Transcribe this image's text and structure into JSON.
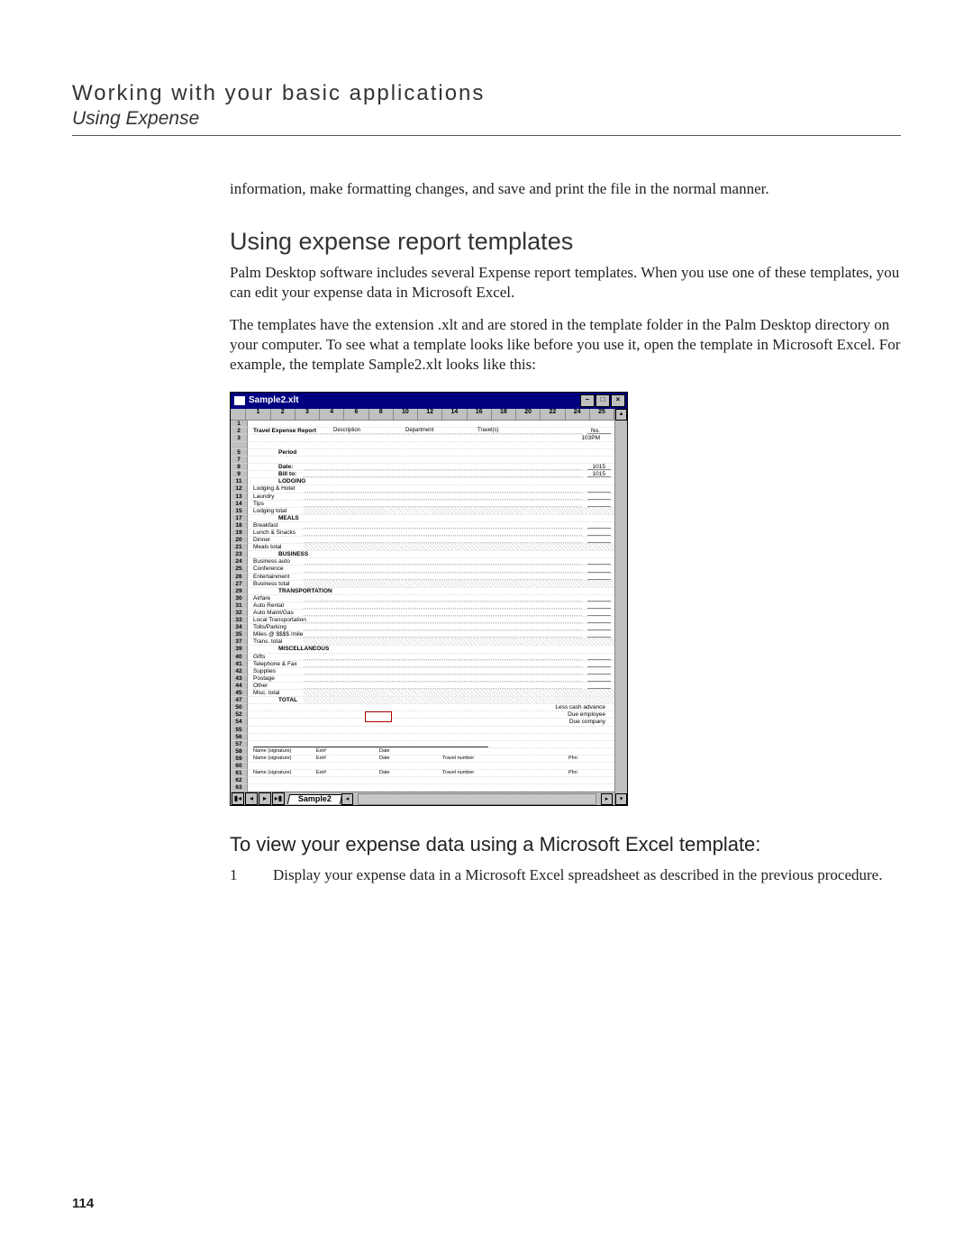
{
  "header": {
    "title": "Working with your basic applications",
    "subtitle": "Using Expense"
  },
  "lead_fragment": "information, make formatting changes, and save and print the file in the normal manner.",
  "section_heading": "Using expense report templates",
  "para1": "Palm Desktop software includes several Expense report templates. When you use one of these templates, you can edit your expense data in Microsoft Excel.",
  "para2": "The templates have the extension .xlt and are stored in the template folder in the Palm Desktop directory on your computer. To see what a template looks like before you use it, open the template in Microsoft Excel. For example, the template Sample2.xlt looks like this:",
  "excel": {
    "window_title": "Sample2.xlt",
    "col_headers": [
      "1",
      "2",
      "3",
      "4",
      "6",
      "8",
      "10",
      "12",
      "14",
      "16",
      "18",
      "20",
      "22",
      "24",
      "25"
    ],
    "rows": [
      {
        "n": "1",
        "label": "",
        "kind": "blank"
      },
      {
        "n": "2",
        "label": "Travel Expense Report",
        "kind": "bold",
        "extra_labels": [
          "Description",
          "Department",
          "Travel(s)"
        ],
        "right": "",
        "right2": "No."
      },
      {
        "n": "3",
        "label": "",
        "kind": "blank",
        "right2": "103PM"
      },
      {
        "n": "",
        "label": "",
        "kind": "blank"
      },
      {
        "n": "5",
        "label": "",
        "kind": "sub",
        "sublabel": "Period"
      },
      {
        "n": "7",
        "label": "",
        "kind": "blank"
      },
      {
        "n": "8",
        "label": "",
        "kind": "right",
        "sublabel": "Date:",
        "right": "1015"
      },
      {
        "n": "9",
        "label": "",
        "kind": "right",
        "sublabel": "Bill to:",
        "right": "1015"
      },
      {
        "n": "11",
        "label": "",
        "kind": "section",
        "sublabel": "LODGING"
      },
      {
        "n": "12",
        "label": "Lodging & Hotel",
        "kind": "item"
      },
      {
        "n": "13",
        "label": "Laundry",
        "kind": "item"
      },
      {
        "n": "14",
        "label": "Tips",
        "kind": "item"
      },
      {
        "n": "15",
        "label": "Lodging total",
        "kind": "shaded"
      },
      {
        "n": "17",
        "label": "",
        "kind": "section",
        "sublabel": "MEALS"
      },
      {
        "n": "18",
        "label": "Breakfast",
        "kind": "item"
      },
      {
        "n": "19",
        "label": "Lunch & Snacks",
        "kind": "item"
      },
      {
        "n": "20",
        "label": "Dinner",
        "kind": "item"
      },
      {
        "n": "21",
        "label": "Meals total",
        "kind": "shaded"
      },
      {
        "n": "23",
        "label": "",
        "kind": "section",
        "sublabel": "BUSINESS"
      },
      {
        "n": "24",
        "label": "Business auto",
        "kind": "item"
      },
      {
        "n": "25",
        "label": "Conference",
        "kind": "item"
      },
      {
        "n": "26",
        "label": "Entertainment",
        "kind": "item"
      },
      {
        "n": "27",
        "label": "Business total",
        "kind": "shaded"
      },
      {
        "n": "29",
        "label": "",
        "kind": "section",
        "sublabel": "TRANSPORTATION"
      },
      {
        "n": "30",
        "label": "Airfare",
        "kind": "item"
      },
      {
        "n": "31",
        "label": "Auto Rental",
        "kind": "item"
      },
      {
        "n": "32",
        "label": "Auto Maint/Gas",
        "kind": "item"
      },
      {
        "n": "33",
        "label": "Local Transportation",
        "kind": "item"
      },
      {
        "n": "34",
        "label": "Tolls/Parking",
        "kind": "item"
      },
      {
        "n": "35",
        "label": "Miles @ $$$$ /mile",
        "kind": "item"
      },
      {
        "n": "37",
        "label": "Trans. total",
        "kind": "shaded"
      },
      {
        "n": "39",
        "label": "",
        "kind": "section",
        "sublabel": "MISCELLANEOUS"
      },
      {
        "n": "40",
        "label": "Gifts",
        "kind": "item"
      },
      {
        "n": "41",
        "label": "Telephone & Fax",
        "kind": "item"
      },
      {
        "n": "42",
        "label": "Supplies",
        "kind": "item"
      },
      {
        "n": "43",
        "label": "Postage",
        "kind": "item"
      },
      {
        "n": "44",
        "label": "Other",
        "kind": "item"
      },
      {
        "n": "45",
        "label": "Misc. total",
        "kind": "shaded"
      },
      {
        "n": "47",
        "label": "",
        "kind": "total",
        "sublabel": "TOTAL"
      },
      {
        "n": "50",
        "label": "",
        "kind": "note",
        "right": "Less cash advance"
      },
      {
        "n": "52",
        "label": "",
        "kind": "redbox",
        "right": "Due employee"
      },
      {
        "n": "54",
        "label": "",
        "kind": "note",
        "right": "Due company"
      },
      {
        "n": "55",
        "label": "",
        "kind": "blank"
      },
      {
        "n": "56",
        "label": "",
        "kind": "blank"
      },
      {
        "n": "57",
        "label": "",
        "kind": "sign",
        "sigrow": true
      },
      {
        "n": "58",
        "label": "",
        "kind": "sign",
        "cols": [
          "Name (signature)",
          "Ext#",
          "Date"
        ]
      },
      {
        "n": "59",
        "label": "",
        "kind": "sign",
        "cols": [
          "Name (signature)",
          "Ext#",
          "Date",
          "Travel number",
          "",
          "Phn"
        ]
      },
      {
        "n": "60",
        "label": "",
        "kind": "blank"
      },
      {
        "n": "61",
        "label": "",
        "kind": "sign",
        "cols": [
          "Name (signature)",
          "Ext#",
          "Date",
          "Travel number",
          "",
          "Phn"
        ]
      },
      {
        "n": "62",
        "label": "",
        "kind": "blank"
      },
      {
        "n": "63",
        "label": "",
        "kind": "blank"
      }
    ],
    "tab_name": "Sample2"
  },
  "subheading": "To view your expense data using a Microsoft Excel template:",
  "step1_num": "1",
  "step1_text": "Display your expense data in a Microsoft Excel spreadsheet as described in the previous procedure.",
  "page_number": "114"
}
